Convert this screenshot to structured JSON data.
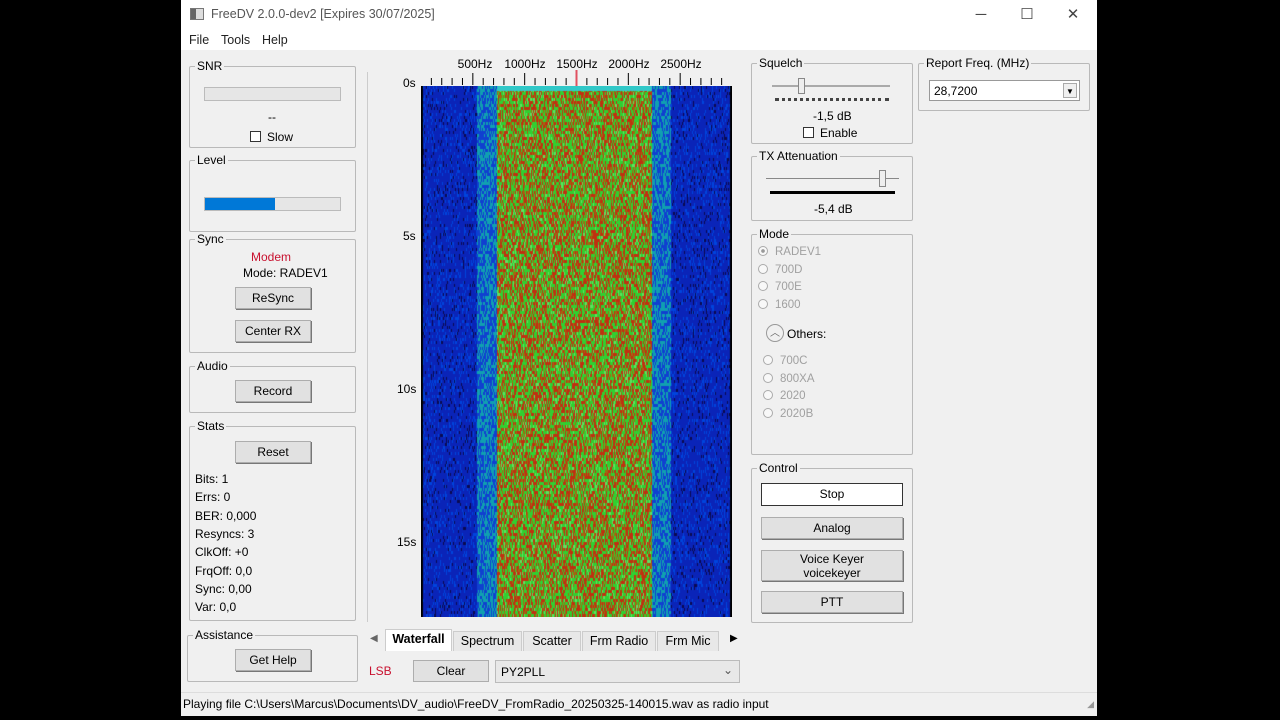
{
  "window": {
    "title": "FreeDV 2.0.0-dev2 [Expires 30/07/2025]",
    "minimize": "─",
    "maximize": "☐",
    "close": "✕"
  },
  "menu": [
    "File",
    "Tools",
    "Help"
  ],
  "snr": {
    "label": "SNR",
    "value": "--",
    "slow_label": "Slow"
  },
  "level": {
    "label": "Level",
    "fill_percent": 52
  },
  "sync": {
    "label": "Sync",
    "status": "Modem",
    "mode": "Mode: RADEV1",
    "resync": "ReSync",
    "center_rx": "Center RX"
  },
  "audio": {
    "label": "Audio",
    "record": "Record"
  },
  "stats": {
    "label": "Stats",
    "reset": "Reset",
    "lines": [
      "Bits: 1",
      "Errs: 0",
      "BER: 0,000",
      "Resyncs: 3",
      "ClkOff: +0",
      "FrqOff: 0,0",
      "Sync: 0,00",
      "Var: 0,0"
    ]
  },
  "assistance": {
    "label": "Assistance",
    "get_help": "Get Help"
  },
  "waterfall": {
    "freq_labels": [
      "500Hz",
      "1000Hz",
      "1500Hz",
      "2000Hz",
      "2500Hz"
    ],
    "time_labels": [
      "0s",
      "5s",
      "10s",
      "15s"
    ],
    "tuned_freq_hz": 1500
  },
  "tabs": [
    "Waterfall",
    "Spectrum",
    "Scatter",
    "Frm Radio",
    "Frm Mic"
  ],
  "bottom": {
    "sideband": "LSB",
    "clear": "Clear",
    "callsign": "PY2PLL"
  },
  "squelch": {
    "label": "Squelch",
    "value": "-1,5 dB",
    "enable": "Enable",
    "slider_fraction": 0.22
  },
  "tx_atten": {
    "label": "TX Attenuation",
    "value": "-5,4 dB",
    "slider_fraction": 0.85
  },
  "report": {
    "label": "Report Freq. (MHz)",
    "value": "28,7200"
  },
  "mode": {
    "label": "Mode",
    "options": [
      "RADEV1",
      "700D",
      "700E",
      "1600"
    ],
    "others": "Others:",
    "other_options": [
      "700C",
      "800XA",
      "2020",
      "2020B"
    ]
  },
  "control": {
    "label": "Control",
    "stop": "Stop",
    "analog": "Analog",
    "voice_keyer": "Voice Keyer",
    "voice_keyer_sub": "voicekeyer",
    "ptt": "PTT"
  },
  "status": "Playing file C:\\Users\\Marcus\\Documents\\DV_audio\\FreeDV_FromRadio_20250325-140015.wav as radio input",
  "colors": {
    "accent": "#0078d7",
    "alert": "#c8102e"
  }
}
